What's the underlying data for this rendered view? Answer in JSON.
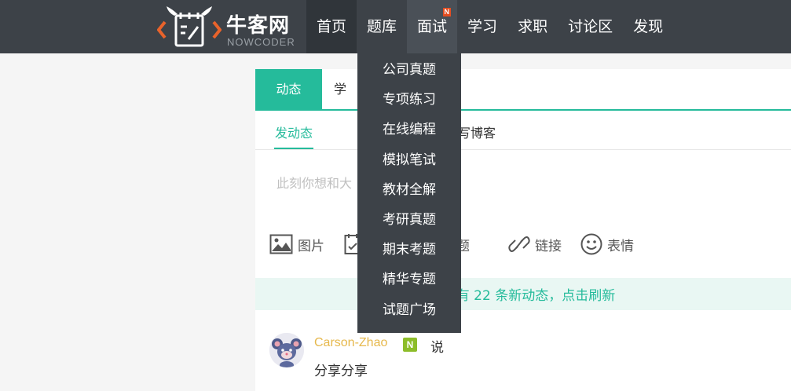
{
  "logo": {
    "cn": "牛客网",
    "en": "NOWCODER"
  },
  "nav": {
    "items": [
      {
        "label": "首页"
      },
      {
        "label": "题库"
      },
      {
        "label": "面试",
        "badge": "N"
      },
      {
        "label": "学习"
      },
      {
        "label": "求职"
      },
      {
        "label": "讨论区"
      },
      {
        "label": "发现"
      }
    ]
  },
  "dropdown": {
    "items": [
      "公司真题",
      "专项练习",
      "在线编程",
      "模拟笔试",
      "教材全解",
      "考研真题",
      "期末考题",
      "精华专题",
      "试题广场"
    ]
  },
  "tabs": {
    "active": "动态",
    "second": "学"
  },
  "subtabs": {
    "active": "发动态",
    "second": "写博客"
  },
  "compose": {
    "placeholder": "此刻你想和大"
  },
  "tools": {
    "image": "图片",
    "topic": "题",
    "link": "链接",
    "emoji": "表情"
  },
  "refresh": {
    "text": "有 22 条新动态，点击刷新"
  },
  "post": {
    "user": "Carson-Zhao",
    "badge": "N",
    "verb": "说",
    "content": "分享分享"
  },
  "colors": {
    "accent": "#25bb9b",
    "nav_bg": "#3d4248",
    "username": "#e6b84c",
    "badge_green": "#8dbd2a",
    "badge_red": "#e54d20"
  }
}
